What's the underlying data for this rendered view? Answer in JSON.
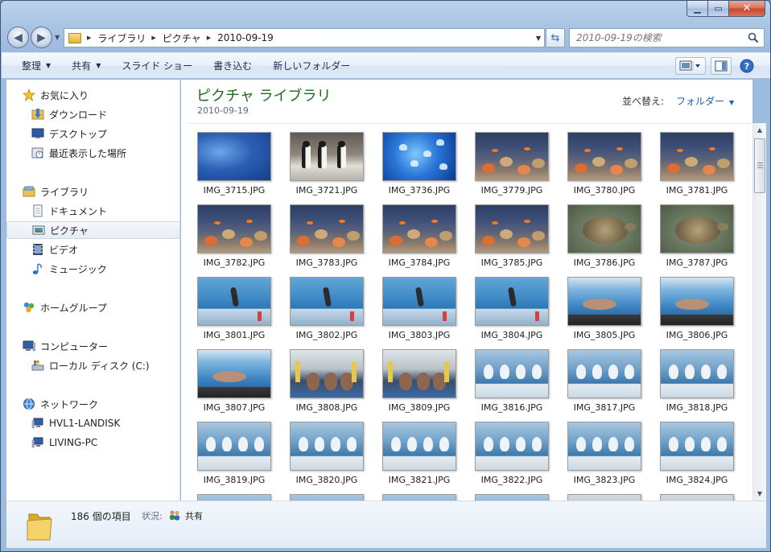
{
  "window": {
    "minimize_icon": "minimize-icon",
    "maximize_icon": "maximize-icon",
    "close_icon": "close-icon"
  },
  "address": {
    "crumbs": [
      "ライブラリ",
      "ピクチャ",
      "2010-09-19"
    ]
  },
  "search": {
    "placeholder": "2010-09-19の検索"
  },
  "toolbar": {
    "organize": "整理",
    "share": "共有",
    "slideshow": "スライド ショー",
    "burn": "書き込む",
    "new_folder": "新しいフォルダー"
  },
  "navigation": {
    "favorites": "お気に入り",
    "downloads": "ダウンロード",
    "desktop": "デスクトップ",
    "recent_places": "最近表示した場所",
    "libraries": "ライブラリ",
    "documents": "ドキュメント",
    "pictures": "ピクチャ",
    "videos": "ビデオ",
    "music": "ミュージック",
    "homegroup": "ホームグループ",
    "computer": "コンピューター",
    "local_disk": "ローカル ディスク (C:)",
    "network": "ネットワーク",
    "network_hvl": "HVL1-LANDISK",
    "network_living": "LIVING-PC"
  },
  "library": {
    "title": "ピクチャ ライブラリ",
    "subtitle": "2010-09-19",
    "arrange_label": "並べ替え:",
    "arrange_value": "フォルダー"
  },
  "files": [
    {
      "name": "IMG_3715.JPG",
      "scene": "fish"
    },
    {
      "name": "IMG_3721.JPG",
      "scene": "penguin"
    },
    {
      "name": "IMG_3736.JPG",
      "scene": "jelly"
    },
    {
      "name": "IMG_3779.JPG",
      "scene": "coral"
    },
    {
      "name": "IMG_3780.JPG",
      "scene": "coral"
    },
    {
      "name": "IMG_3781.JPG",
      "scene": "coral"
    },
    {
      "name": "IMG_3782.JPG",
      "scene": "coral"
    },
    {
      "name": "IMG_3783.JPG",
      "scene": "coral"
    },
    {
      "name": "IMG_3784.JPG",
      "scene": "coral"
    },
    {
      "name": "IMG_3785.JPG",
      "scene": "coral"
    },
    {
      "name": "IMG_3786.JPG",
      "scene": "turtle"
    },
    {
      "name": "IMG_3787.JPG",
      "scene": "turtle"
    },
    {
      "name": "IMG_3801.JPG",
      "scene": "pool"
    },
    {
      "name": "IMG_3802.JPG",
      "scene": "pool"
    },
    {
      "name": "IMG_3803.JPG",
      "scene": "pool"
    },
    {
      "name": "IMG_3804.JPG",
      "scene": "pool"
    },
    {
      "name": "IMG_3805.JPG",
      "scene": "seal"
    },
    {
      "name": "IMG_3806.JPG",
      "scene": "seal"
    },
    {
      "name": "IMG_3807.JPG",
      "scene": "seal"
    },
    {
      "name": "IMG_3808.JPG",
      "scene": "walrus"
    },
    {
      "name": "IMG_3809.JPG",
      "scene": "walrus"
    },
    {
      "name": "IMG_3816.JPG",
      "scene": "beluga"
    },
    {
      "name": "IMG_3817.JPG",
      "scene": "beluga"
    },
    {
      "name": "IMG_3818.JPG",
      "scene": "beluga"
    },
    {
      "name": "IMG_3819.JPG",
      "scene": "beluga"
    },
    {
      "name": "IMG_3820.JPG",
      "scene": "beluga"
    },
    {
      "name": "IMG_3821.JPG",
      "scene": "beluga"
    },
    {
      "name": "IMG_3822.JPG",
      "scene": "beluga"
    },
    {
      "name": "IMG_3823.JPG",
      "scene": "beluga"
    },
    {
      "name": "IMG_3824.JPG",
      "scene": "beluga"
    }
  ],
  "details": {
    "item_count": "186 個の項目",
    "status_label": "状況:",
    "status_value": "共有"
  }
}
